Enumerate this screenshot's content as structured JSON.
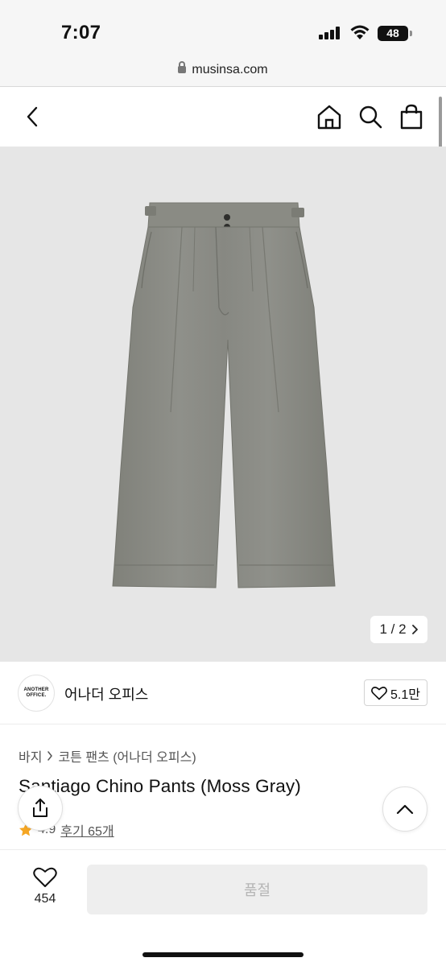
{
  "status_bar": {
    "time": "7:07",
    "battery": "48"
  },
  "url_bar": {
    "domain": "musinsa.com"
  },
  "nav": {
    "back_icon": "chevron-left-icon",
    "home_icon": "home-icon",
    "search_icon": "search-icon",
    "bag_icon": "shopping-bag-icon"
  },
  "gallery": {
    "counter": "1 / 2",
    "next_icon": "chevron-right-icon",
    "background": "#e6e6e6",
    "product_color": "#8b8c85"
  },
  "brand": {
    "logo_line1": "ANOTHER",
    "logo_line2": "OFFICE.",
    "name": "어나더 오피스",
    "likes": "5.1만"
  },
  "breadcrumb": {
    "category": "바지",
    "subcategory": "코튼 팬츠 (어나더 오피스)"
  },
  "product": {
    "title": "Santiago Chino Pants (Moss Gray)",
    "rating": "4.9",
    "reviews": "후기 65개",
    "star_color": "#f5a623"
  },
  "bottom_bar": {
    "like_count": "454",
    "buy_label": "품절"
  }
}
